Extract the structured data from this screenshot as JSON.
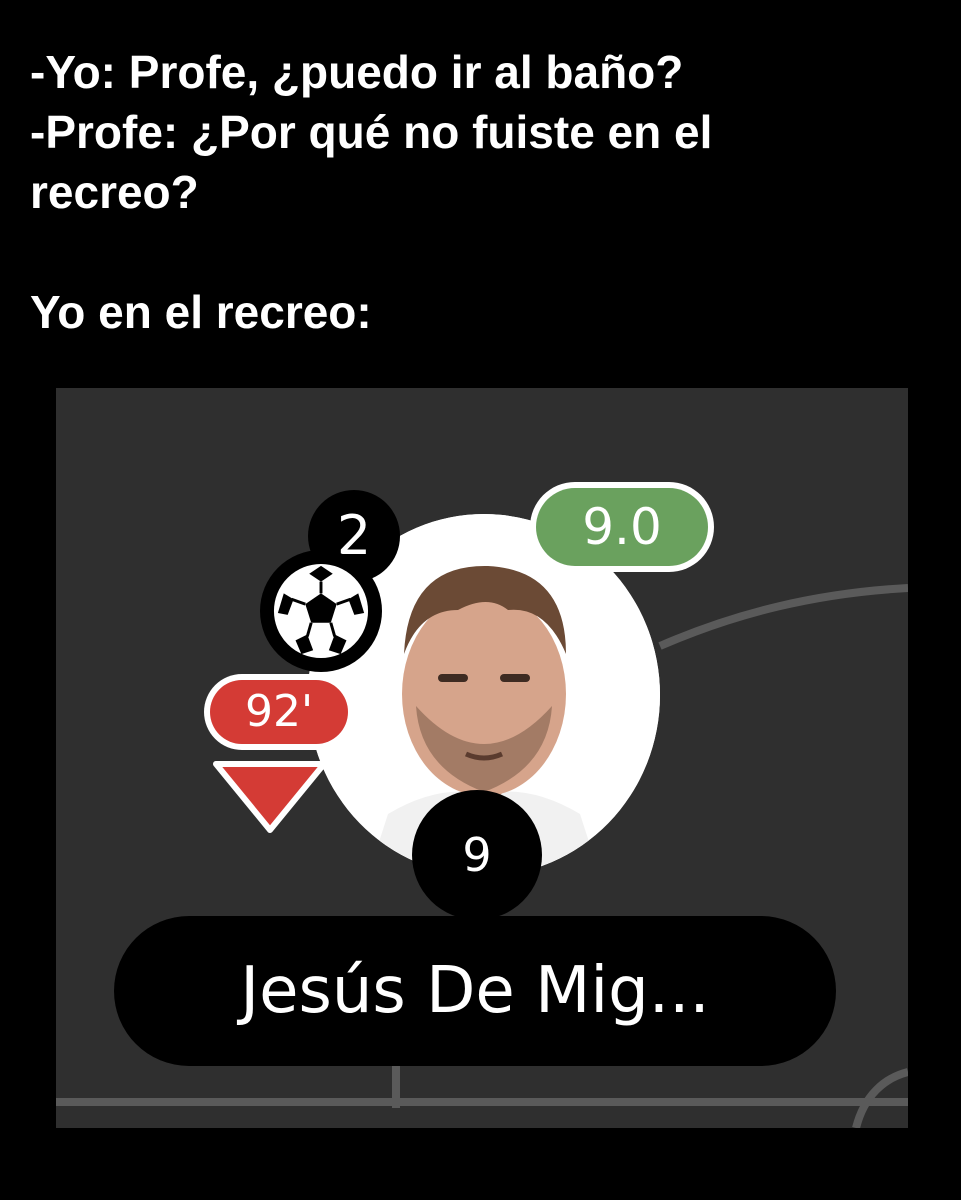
{
  "caption": {
    "line1": "-Yo: Profe, ¿puedo ir al baño?",
    "line2": "-Profe: ¿Por qué no fuiste en el",
    "line3": "recreo?",
    "line4": "Yo en el recreo:"
  },
  "player_card": {
    "goals": "2",
    "rating": "9.0",
    "rating_color": "#6aa15e",
    "substitution_minute": "92'",
    "substitution_color": "#d43b35",
    "shirt_number": "9",
    "name": "Jesús De Mig...",
    "icons": [
      "soccer-ball-icon",
      "substitution-down-arrow-icon"
    ]
  }
}
